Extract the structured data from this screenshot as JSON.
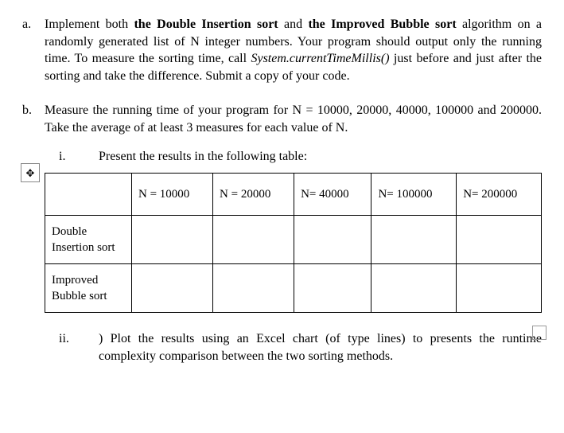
{
  "a": {
    "label": "a.",
    "pre1": "Implement both ",
    "bold1": "the Double Insertion sort",
    "mid1": " and ",
    "bold2": "the Improved Bubble sort",
    "post1": " algorithm on a randomly generated list of N integer numbers. Your program should output only the running time. To measure the sorting time, call ",
    "code": "System.currentTimeMillis()",
    "post2": " just before and just after the sorting and take the difference. Submit a copy of your code."
  },
  "b": {
    "label": "b.",
    "text": "Measure the running time of your program for N = 10000, 20000, 40000, 100000 and 200000. Take the average of at least 3 measures for each value of N."
  },
  "bi": {
    "label": "i.",
    "text": "Present the results in the following table:"
  },
  "table": {
    "headers": [
      "",
      "N = 10000",
      "N = 20000",
      "N= 40000",
      "N= 100000",
      "N= 200000"
    ],
    "rows": [
      {
        "label": "Double Insertion sort",
        "cells": [
          "",
          "",
          "",
          "",
          ""
        ]
      },
      {
        "label": "Improved Bubble sort",
        "cells": [
          "",
          "",
          "",
          "",
          ""
        ]
      }
    ]
  },
  "bii": {
    "label": "ii.",
    "text": ") Plot the results using an Excel chart (of type lines) to presents the runtime complexity comparison between the two sorting methods."
  }
}
